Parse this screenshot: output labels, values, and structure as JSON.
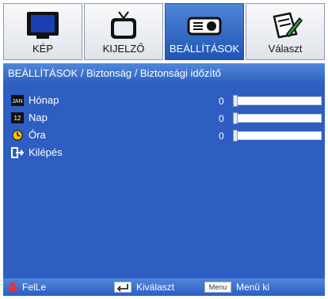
{
  "colors": {
    "accent": "#2f5ec3",
    "header": "#2c5fc0",
    "active_tab": "#1f55b5"
  },
  "tabs": [
    {
      "label": "KÉP",
      "icon": "monitor-icon"
    },
    {
      "label": "KIJELZŐ",
      "icon": "tv-icon"
    },
    {
      "label": "BEÁLLÍTÁSOK",
      "icon": "projector-icon"
    },
    {
      "label": "Választ",
      "icon": "notepad-pen-icon"
    }
  ],
  "breadcrumb": "BEÁLLÍTÁSOK / Biztonság / Biztonsági időzítő",
  "rows": [
    {
      "label": "Hónap",
      "icon": "jan-calendar-icon",
      "icon_text": "JAN",
      "value": "0"
    },
    {
      "label": "Nap",
      "icon": "day-number-icon",
      "icon_text": "12",
      "value": "0"
    },
    {
      "label": "Óra",
      "icon": "clock-icon",
      "value": "0"
    },
    {
      "label": "Kilépés",
      "icon": "exit-icon"
    }
  ],
  "footer": {
    "items": [
      {
        "label": "FelLe",
        "icon": "up-down-arrows-icon"
      },
      {
        "label": "Kiválaszt",
        "icon": "enter-key-icon"
      },
      {
        "label": "Menü ki",
        "icon": "menu-key-icon",
        "key_text": "Menu"
      }
    ]
  }
}
